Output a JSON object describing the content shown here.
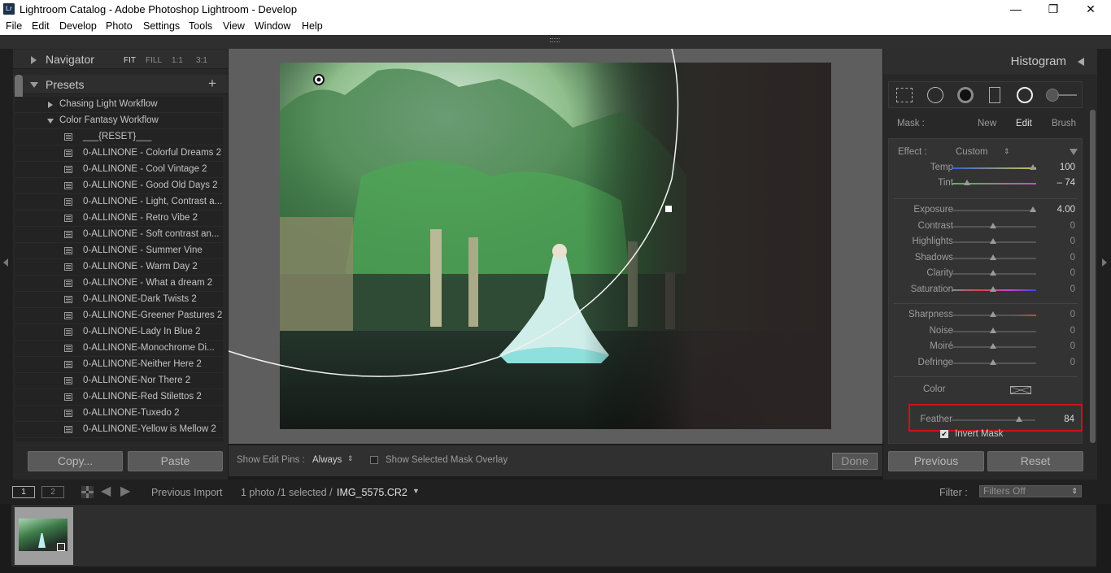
{
  "window": {
    "title": "Lightroom Catalog - Adobe Photoshop Lightroom - Develop",
    "app_icon": "Lr",
    "minimize": "—",
    "maximize": "❐",
    "close": "✕"
  },
  "menu": [
    "File",
    "Edit",
    "Develop",
    "Photo",
    "Settings",
    "Tools",
    "View",
    "Window",
    "Help"
  ],
  "left_panel": {
    "navigator": {
      "label": "Navigator",
      "options": [
        "FIT",
        "FILL",
        "1:1",
        "3:1"
      ]
    },
    "presets": {
      "label": "Presets",
      "add": "+",
      "folders": [
        {
          "label": "Chasing Light Workflow",
          "expanded": false
        },
        {
          "label": "Color Fantasy Workflow",
          "expanded": true
        }
      ],
      "items": [
        "___{RESET}___",
        "0-ALLINONE - Colorful Dreams 2",
        "0-ALLINONE - Cool Vintage 2",
        "0-ALLINONE - Good Old Days 2",
        "0-ALLINONE - Light, Contrast a...",
        "0-ALLINONE - Retro Vibe 2",
        "0-ALLINONE - Soft contrast an...",
        "0-ALLINONE - Summer Vine",
        "0-ALLINONE - Warm Day 2",
        "0-ALLINONE - What a dream 2",
        "0-ALLINONE-Dark Twists 2",
        "0-ALLINONE-Greener Pastures 2",
        "0-ALLINONE-Lady In Blue 2",
        "0-ALLINONE-Monochrome Di...",
        "0-ALLINONE-Neither Here 2",
        "0-ALLINONE-Nor There 2",
        "0-ALLINONE-Red Stilettos 2",
        "0-ALLINONE-Tuxedo 2",
        "0-ALLINONE-Yellow is Mellow 2"
      ]
    },
    "copy_button": "Copy...",
    "paste_button": "Paste"
  },
  "toolbar": {
    "show_edit_pins_label": "Show Edit Pins :",
    "show_edit_pins_value": "Always",
    "mask_overlay_label": "Show Selected Mask Overlay",
    "done_button": "Done"
  },
  "right_panel": {
    "histogram_label": "Histogram",
    "mask": {
      "label": "Mask :",
      "new": "New",
      "edit": "Edit",
      "brush": "Brush"
    },
    "effect": {
      "label": "Effect :",
      "value": "Custom"
    },
    "sliders_group1": [
      {
        "label": "Temp",
        "value": "100",
        "pos": 1.0
      },
      {
        "label": "Tint",
        "value": "– 74",
        "pos": 0.18
      }
    ],
    "sliders_group2": [
      {
        "label": "Exposure",
        "value": "4.00",
        "pos": 1.0
      },
      {
        "label": "Contrast",
        "value": "0",
        "pos": 0.5
      },
      {
        "label": "Highlights",
        "value": "0",
        "pos": 0.5
      },
      {
        "label": "Shadows",
        "value": "0",
        "pos": 0.5
      },
      {
        "label": "Clarity",
        "value": "0",
        "pos": 0.5
      },
      {
        "label": "Saturation",
        "value": "0",
        "pos": 0.5
      }
    ],
    "sliders_group3": [
      {
        "label": "Sharpness",
        "value": "0",
        "pos": 0.5
      },
      {
        "label": "Noise",
        "value": "0",
        "pos": 0.5
      },
      {
        "label": "Moiré",
        "value": "0",
        "pos": 0.5
      },
      {
        "label": "Defringe",
        "value": "0",
        "pos": 0.5
      }
    ],
    "color_label": "Color",
    "feather": {
      "label": "Feather",
      "value": "84",
      "pos": 0.84
    },
    "invert_mask": {
      "label": "Invert Mask",
      "checked": true,
      "checkmark": "✔"
    },
    "previous_button": "Previous",
    "reset_button": "Reset"
  },
  "filmstrip_bar": {
    "screen1": "1",
    "screen2": "2",
    "source": "Previous Import",
    "count": "1 photo /1 selected /",
    "filename": "IMG_5575.CR2",
    "filter_label": "Filter :",
    "filter_value": "Filters Off"
  },
  "colors": {
    "highlight_box": "#d0101a",
    "panel_bg": "#282828",
    "center_bg": "#5e5e5e"
  }
}
